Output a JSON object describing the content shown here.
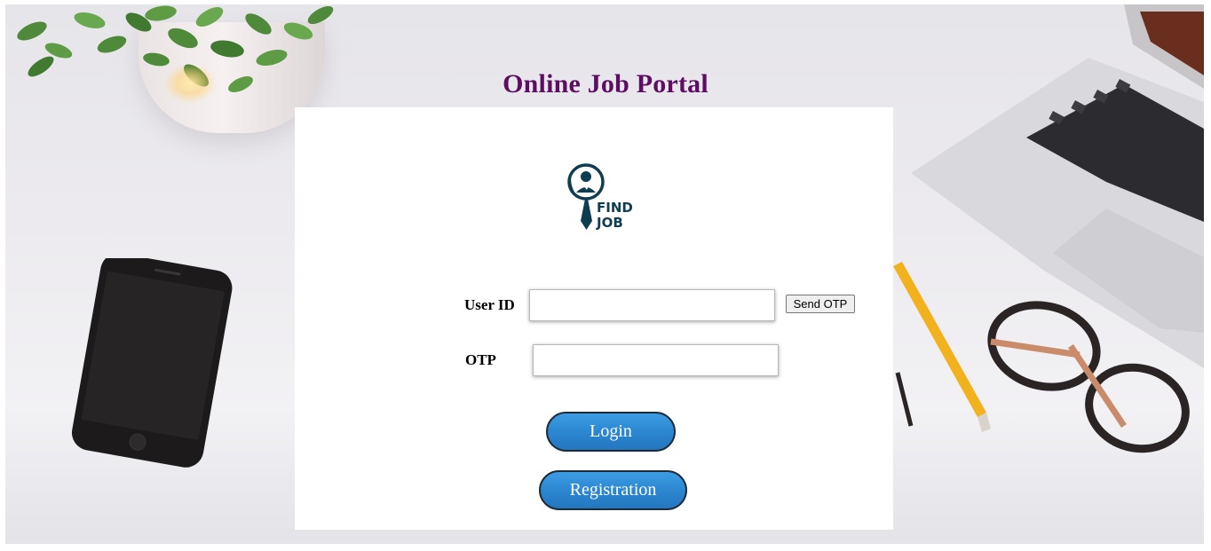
{
  "page": {
    "title": "Online Job Portal"
  },
  "logo": {
    "line1": "FIND",
    "line2": "JOB",
    "color": "#0e3d52"
  },
  "form": {
    "user_id_label": "User ID",
    "user_id_value": "",
    "send_otp_label": "Send OTP",
    "otp_label": "OTP",
    "otp_value": ""
  },
  "buttons": {
    "login_label": "Login",
    "registration_label": "Registration"
  },
  "colors": {
    "title": "#5e0e62",
    "button": "#2b85cf"
  }
}
